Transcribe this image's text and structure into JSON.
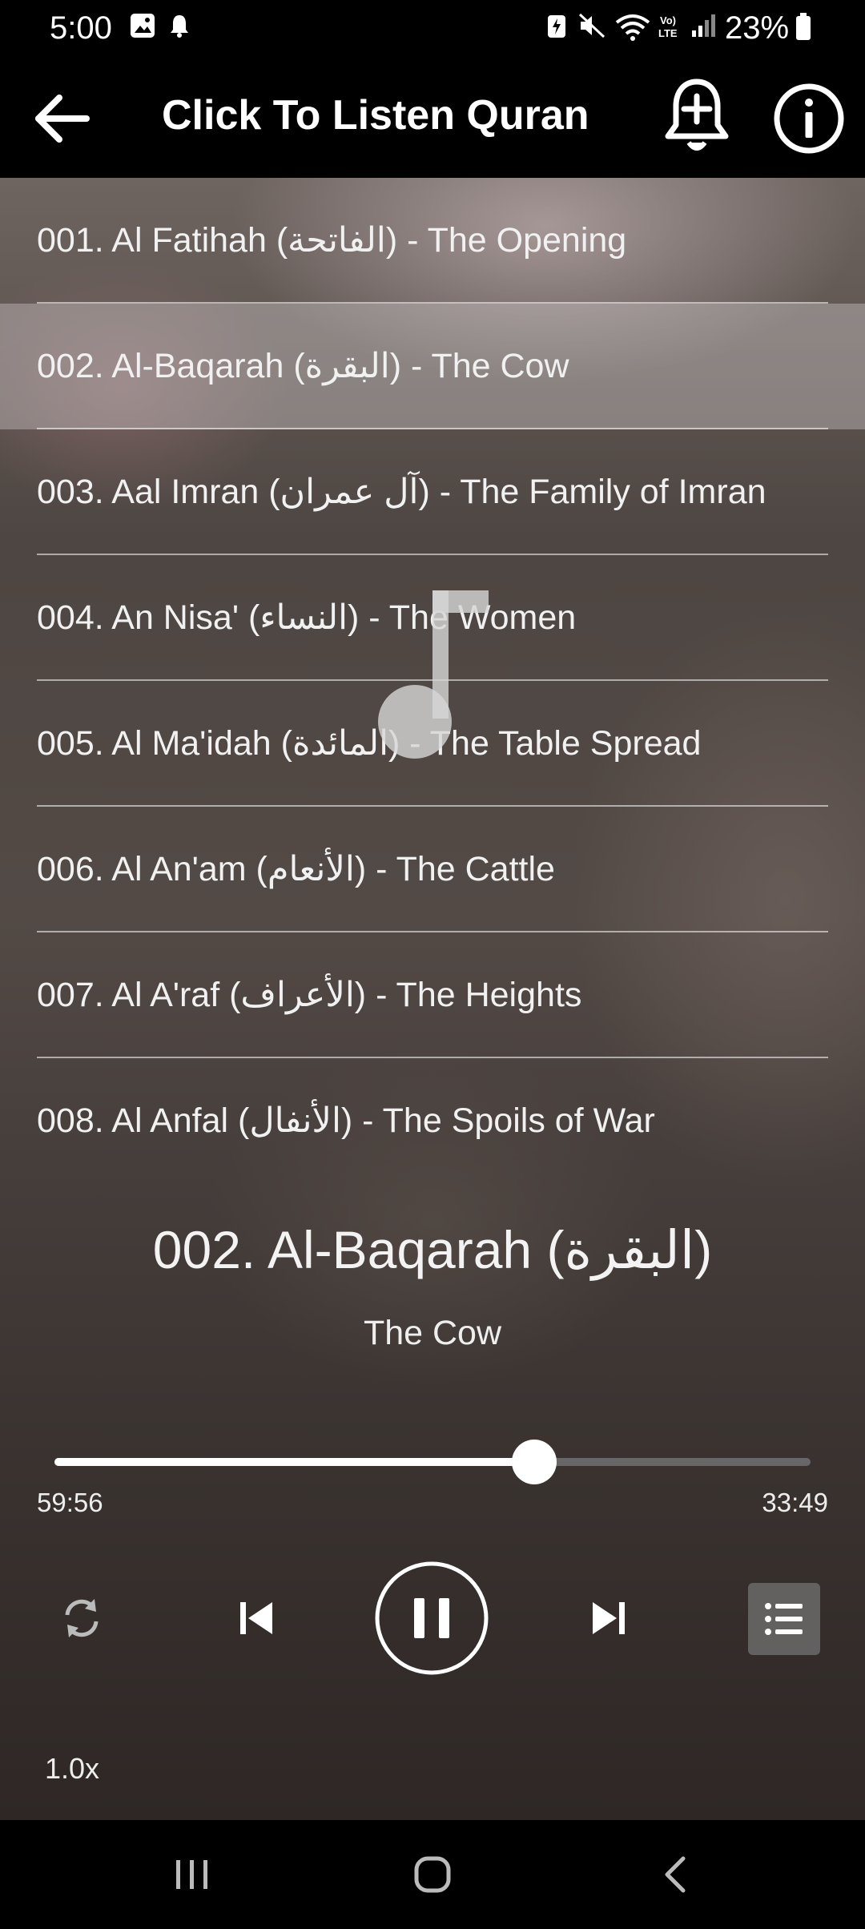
{
  "status_bar": {
    "time": "5:00",
    "battery": "23%"
  },
  "app_bar": {
    "title": "Click To Listen Quran"
  },
  "surah_list": [
    {
      "label": "001. Al Fatihah (الفاتحة) - The Opening",
      "selected": false
    },
    {
      "label": "002. Al-Baqarah (البقرة) - The Cow",
      "selected": true
    },
    {
      "label": "003. Aal Imran (آل عمران) - The Family of Imran",
      "selected": false
    },
    {
      "label": "004. An Nisa' (النساء) - The Women",
      "selected": false
    },
    {
      "label": "005. Al Ma'idah (المائدة) - The Table Spread",
      "selected": false
    },
    {
      "label": "006. Al An'am (الأنعام) - The Cattle",
      "selected": false
    },
    {
      "label": "007. Al A'raf (الأعراف) - The Heights",
      "selected": false
    },
    {
      "label": "008. Al Anfal (الأنفال) - The Spoils of War",
      "selected": false
    }
  ],
  "now_playing": {
    "title": "002. Al-Baqarah (البقرة)",
    "subtitle": "The Cow",
    "progress": 0.635,
    "elapsed": "59:56",
    "total": "33:49",
    "speed": "1.0x"
  },
  "icons": {
    "back": "arrow-left-icon",
    "bell": "bell-plus-icon",
    "info": "info-icon",
    "repeat": "repeat-icon",
    "prev": "skip-previous-icon",
    "pause": "pause-icon",
    "next": "skip-next-icon",
    "playlist": "playlist-icon",
    "note": "music-note-icon"
  },
  "colors": {
    "bar_background": "#000000",
    "selected_row": "#d7d2d2",
    "text": "#ffffff"
  }
}
